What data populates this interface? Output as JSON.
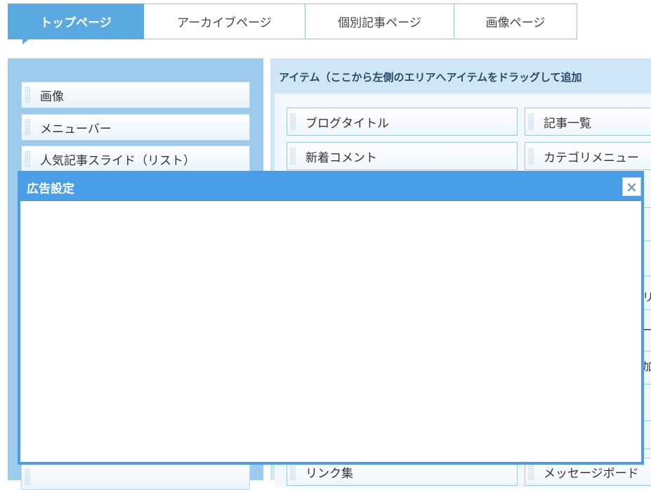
{
  "tabs": [
    {
      "label": "トップページ",
      "active": true
    },
    {
      "label": "アーカイブページ",
      "active": false
    },
    {
      "label": "個別記事ページ",
      "active": false
    },
    {
      "label": "画像ページ",
      "active": false
    }
  ],
  "left_items": [
    "画像",
    "メニューバー",
    "人気記事スライド（リスト）"
  ],
  "right_header": "アイテム（ここから左側のエリアへアイテムをドラッグして追加",
  "right_items": {
    "row1": [
      "ブログタイトル",
      "記事一覧"
    ],
    "row2": [
      "新着コメント",
      "カテゴリメニュー"
    ],
    "bottom": [
      "リンク集",
      "メッセージボード"
    ]
  },
  "edge_glyphs": [
    "リ",
    "ー",
    "加"
  ],
  "dialog": {
    "title": "広告設定",
    "close_symbol": "×"
  },
  "colors": {
    "accent": "#4a9ee8",
    "tab_active": "#5aa9e0",
    "left_area": "#9dcbee",
    "right_area": "#cfe6f7"
  }
}
